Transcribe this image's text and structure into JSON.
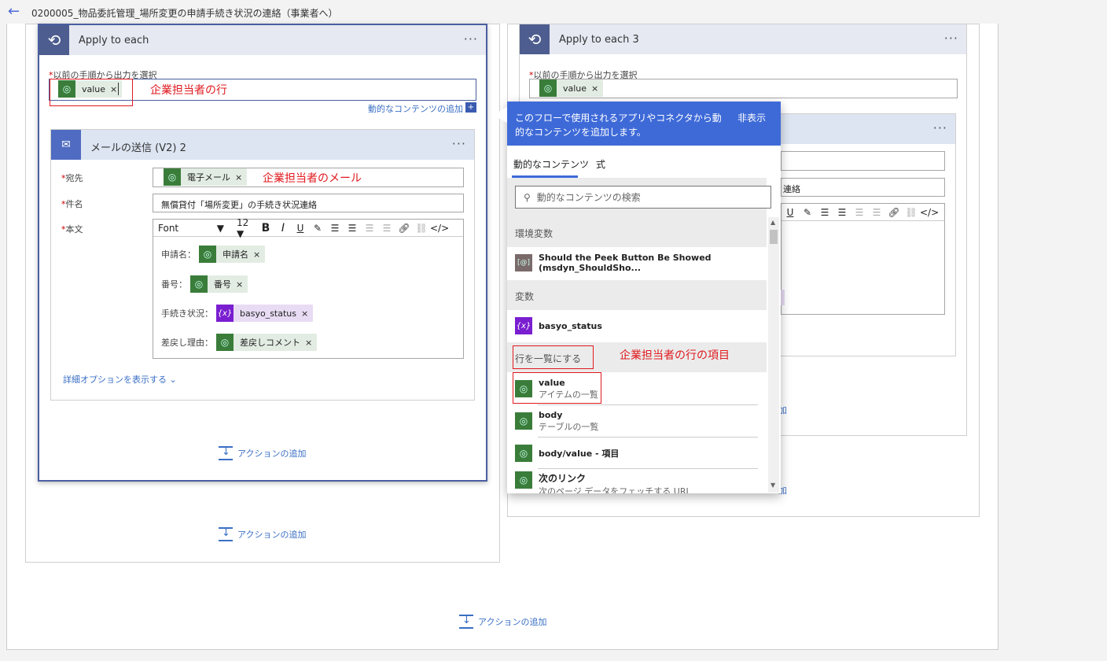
{
  "header": {
    "back_icon": "back-arrow-icon",
    "title": "0200005_物品委託管理_場所変更の申請手続き状況の連絡（事業者へ）"
  },
  "left_card": {
    "title": "Apply to each",
    "field_label": "以前の手順から出力を選択",
    "token": "value",
    "annotation": "企業担当者の行",
    "dynamic_link": "動的なコンテンツの追加",
    "mail": {
      "title": "メールの送信 (V2) 2",
      "to_label": "宛先",
      "to_token": "電子メール",
      "to_annotation": "企業担当者のメール",
      "subject_label": "件名",
      "subject_value": "無償貸付「場所変更」の手続き状況連絡",
      "body_label": "本文",
      "toolbar": {
        "font": "Font",
        "size": "12"
      },
      "lines": [
        {
          "label": "申請名：",
          "token": "申請名",
          "type": "dataverse"
        },
        {
          "label": "番号：",
          "token": "番号",
          "type": "dataverse"
        },
        {
          "label": "手続き状況：",
          "token": "basyo_status",
          "type": "variable"
        },
        {
          "label": "差戻し理由：",
          "token": "差戻しコメント",
          "type": "dataverse"
        }
      ],
      "advanced": "詳細オプションを表示する"
    },
    "add_action_inner": "アクションの追加",
    "add_action_outer": "アクションの追加"
  },
  "right_card": {
    "title": "Apply to each 3",
    "field_label": "以前の手順から出力を選択",
    "token": "value",
    "subject_partial": "連絡",
    "add_link_partial": "加",
    "add_action_partial": "加"
  },
  "bottom_add_action": "アクションの追加",
  "popup": {
    "header_text": "このフローで使用されるアプリやコネクタから動的なコンテンツを追加します。",
    "hide": "非表示",
    "tabs": [
      "動的なコンテンツ",
      "式"
    ],
    "search_placeholder": "動的なコンテンツの検索",
    "sections": [
      {
        "title": "環境変数",
        "items": [
          {
            "name": "Should the Peek Button Be Showed (msdyn_ShouldSho...",
            "desc": ""
          }
        ]
      },
      {
        "title": "変数",
        "items": [
          {
            "name": "basyo_status",
            "desc": ""
          }
        ]
      },
      {
        "title": "行を一覧にする",
        "items": [
          {
            "name": "value",
            "desc": "アイテムの一覧"
          },
          {
            "name": "body",
            "desc": "テーブルの一覧"
          },
          {
            "name": "body/value - 項目",
            "desc": ""
          },
          {
            "name": "次のリンク",
            "desc": "次のページ データをフェッチする URL"
          }
        ]
      }
    ],
    "annotation": "企業担当者の行の項目"
  }
}
